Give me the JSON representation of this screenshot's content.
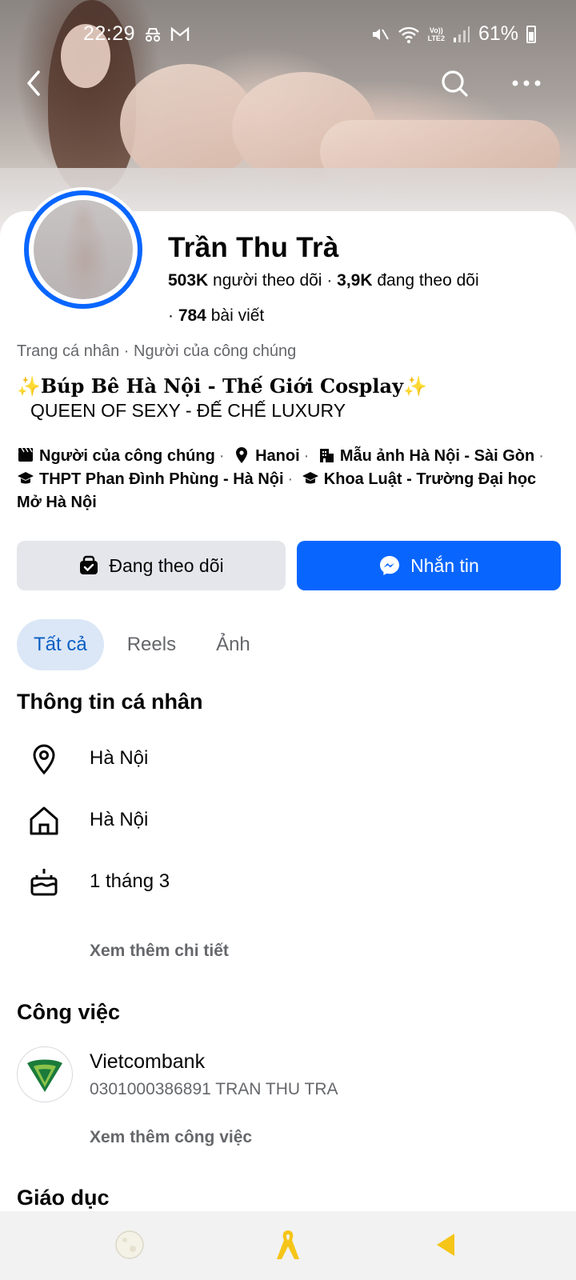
{
  "status_bar": {
    "time": "22:29",
    "battery": "61%"
  },
  "profile": {
    "name": "Trần Thu Trà",
    "followers_count": "503K",
    "followers_label": "người theo dõi",
    "following_count": "3,9K",
    "following_label": "đang theo dõi",
    "posts_count": "784",
    "posts_label": "bài viết",
    "category": "Trang cá nhân · Người của công chúng",
    "bio_line1": "✨Búp Bê Hà Nội - Thế Giới Cosplay✨",
    "bio_line2": "QUEEN OF SEXY - ĐẾ CHẾ LUXURY",
    "details": {
      "public_figure": "Người của công chúng",
      "location": "Hanoi",
      "work": "Mẫu ảnh Hà Nội - Sài Gòn",
      "school1": "THPT Phan Đình Phùng - Hà Nội",
      "school2": "Khoa Luật - Trường Đại học Mở Hà Nội"
    }
  },
  "actions": {
    "following_label": "Đang theo dõi",
    "message_label": "Nhắn tin"
  },
  "tabs": [
    {
      "label": "Tất cả",
      "active": true
    },
    {
      "label": "Reels",
      "active": false
    },
    {
      "label": "Ảnh",
      "active": false
    }
  ],
  "personal_info": {
    "title": "Thông tin cá nhân",
    "current_city": "Hà Nội",
    "hometown": "Hà Nội",
    "birthday": "1 tháng 3",
    "see_more": "Xem thêm chi tiết"
  },
  "work": {
    "title": "Công việc",
    "company": "Vietcombank",
    "subtitle": "0301000386891 TRAN THU TRA",
    "see_more": "Xem thêm công việc"
  },
  "education": {
    "title": "Giáo dục"
  },
  "colors": {
    "accent": "#0866ff",
    "tab_active_bg": "#dbe7f6",
    "button_grey": "#e4e6eb"
  }
}
